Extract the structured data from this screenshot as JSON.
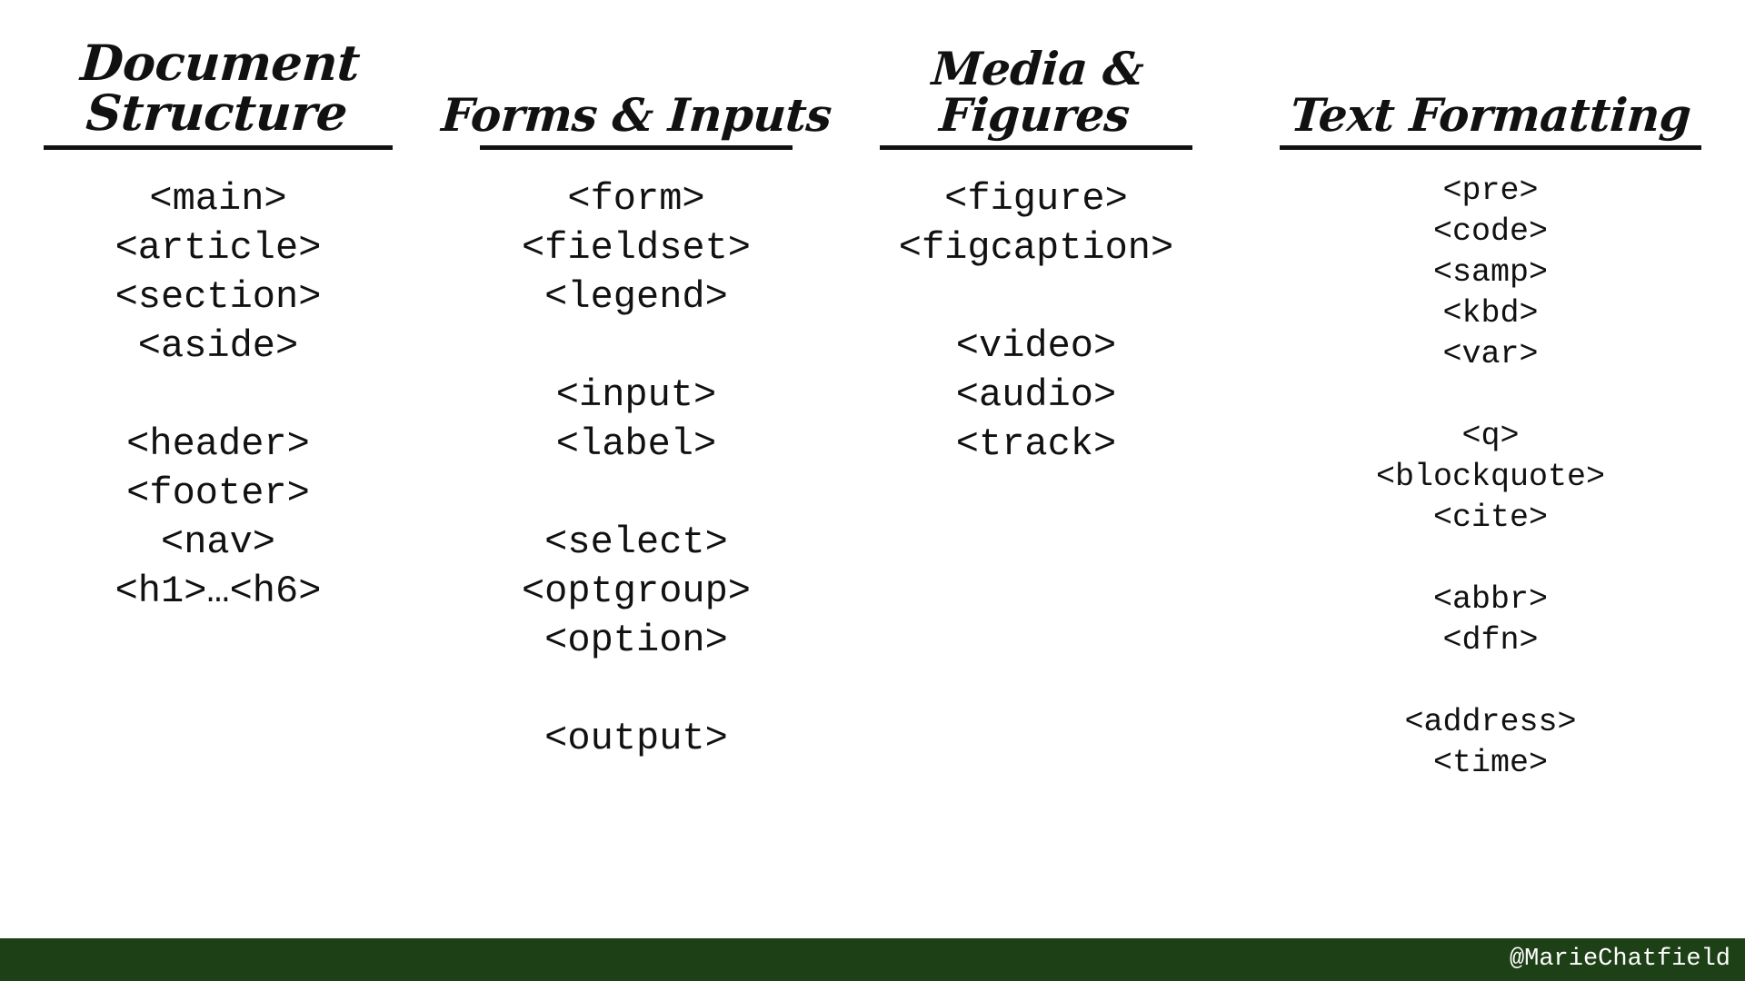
{
  "slide": {
    "background_color": "#ffffff",
    "text_color": "#111111",
    "rule_color": "#111111"
  },
  "columns": [
    {
      "id": "document-structure",
      "heading": "Document\nStructure",
      "groups": [
        {
          "tags": [
            "<main>",
            "<article>",
            "<section>",
            "<aside>"
          ]
        },
        {
          "tags": [
            "<header>",
            "<footer>",
            "<nav>",
            "<h1>…<h6>"
          ]
        }
      ]
    },
    {
      "id": "forms-inputs",
      "heading": "Forms & Inputs",
      "groups": [
        {
          "tags": [
            "<form>",
            "<fieldset>",
            "<legend>"
          ]
        },
        {
          "tags": [
            "<input>",
            "<label>"
          ]
        },
        {
          "tags": [
            "<select>",
            "<optgroup>",
            "<option>"
          ]
        },
        {
          "tags": [
            "<output>"
          ]
        }
      ]
    },
    {
      "id": "media-figures",
      "heading": "Media & Figures",
      "groups": [
        {
          "tags": [
            "<figure>",
            "<figcaption>"
          ]
        },
        {
          "tags": [
            "<video>",
            "<audio>",
            "<track>"
          ]
        }
      ]
    },
    {
      "id": "text-formatting",
      "heading": "Text Formatting",
      "groups": [
        {
          "tags": [
            "<pre>",
            "<code>",
            "<samp>",
            "<kbd>",
            "<var>"
          ]
        },
        {
          "tags": [
            "<q>",
            "<blockquote>",
            "<cite>"
          ]
        },
        {
          "tags": [
            "<abbr>",
            "<dfn>"
          ]
        },
        {
          "tags": [
            "<address>",
            "<time>"
          ]
        }
      ]
    }
  ],
  "footer": {
    "handle": "@MarieChatfield",
    "background_color": "#1e4016",
    "text_color": "#ffffff"
  }
}
